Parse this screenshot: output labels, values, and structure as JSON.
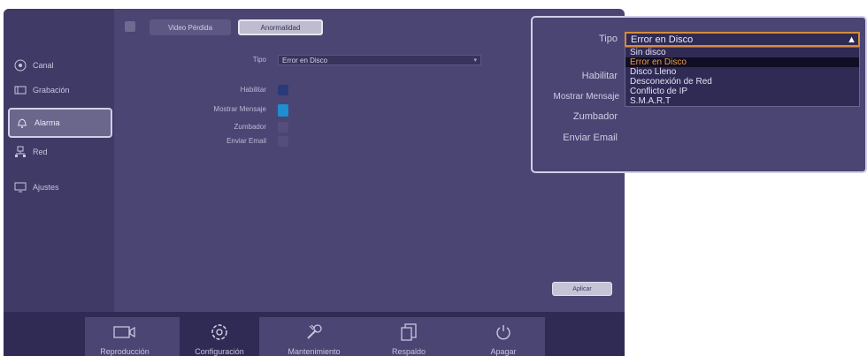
{
  "sidebar": {
    "items": [
      {
        "label": "Canal",
        "icon": "camera-circle-icon"
      },
      {
        "label": "Grabación",
        "icon": "record-icon"
      },
      {
        "label": "Alarma",
        "icon": "alarm-bell-icon"
      },
      {
        "label": "Red",
        "icon": "network-icon"
      },
      {
        "label": "Ajustes",
        "icon": "monitor-icon"
      }
    ],
    "active": "Alarma"
  },
  "tabs": [
    {
      "label": "Video Pérdida"
    },
    {
      "label": "Anormalidad"
    }
  ],
  "active_tab": "Anormalidad",
  "form": {
    "tipo_label": "Tipo",
    "tipo_value": "Error en Disco",
    "habilitar_label": "Habilitar",
    "mostrar_mensaje_label": "Mostrar Mensaje",
    "zumbador_label": "Zumbador",
    "enviar_email_label": "Enviar Email",
    "habilitar_checked": true,
    "mostrar_mensaje_checked": true,
    "zumbador_checked": false,
    "enviar_email_checked": false,
    "apply_label": "Aplicar"
  },
  "bottom_tabs": [
    {
      "label": "Reproducción",
      "icon": "video-camera-icon"
    },
    {
      "label": "Configuración",
      "icon": "gear-icon"
    },
    {
      "label": "Mantenimiento",
      "icon": "wrench-icon"
    },
    {
      "label": "Respaldo",
      "icon": "copy-icon"
    },
    {
      "label": "Apagar",
      "icon": "power-icon"
    }
  ],
  "active_bottom_tab": "Configuración",
  "inset": {
    "tipo_label": "Tipo",
    "habilitar_label": "Habilitar",
    "mostrar_mensaje_label": "Mostrar Mensaje",
    "zumbador_label": "Zumbador",
    "enviar_email_label": "Enviar Email",
    "select_value": "Error en Disco",
    "options": [
      "Sin disco",
      "Error en Disco",
      "Disco Lleno",
      "Desconexión de Red",
      "Conflicto de IP",
      "S.M.A.R.T"
    ],
    "selected_option": "Error en Disco"
  },
  "colors": {
    "panel": "#4a4573",
    "sidebar": "#3f3a66",
    "bottom_bar": "#2f2b54",
    "checkbox_on": "#1e8fd0",
    "checkbox_dark": "#2a3a78",
    "highlight_text": "#f09a3c"
  }
}
